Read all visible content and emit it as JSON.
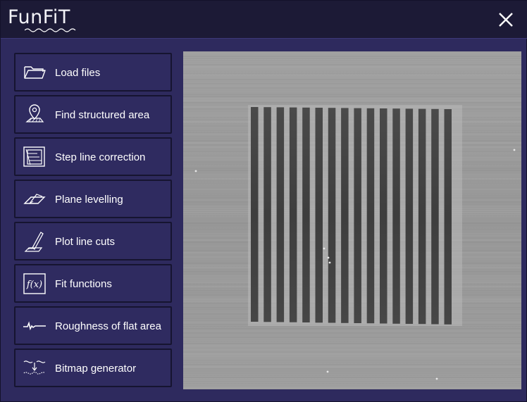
{
  "app": {
    "title": "FunFiT"
  },
  "titlebar": {
    "close_icon": "close-icon"
  },
  "sidebar": {
    "items": [
      {
        "label": "Load files",
        "icon": "folder-icon"
      },
      {
        "label": "Find structured area",
        "icon": "location-pin-icon"
      },
      {
        "label": "Step line correction",
        "icon": "step-correction-icon"
      },
      {
        "label": "Plane levelling",
        "icon": "plane-icon"
      },
      {
        "label": "Plot line cuts",
        "icon": "pen-plot-icon"
      },
      {
        "label": "Fit functions",
        "icon": "function-icon"
      },
      {
        "label": "Roughness of flat area",
        "icon": "profile-icon"
      },
      {
        "label": "Bitmap generator",
        "icon": "bitmap-icon"
      }
    ]
  },
  "colors": {
    "window_bg": "#2e2a5e",
    "titlebar_bg": "#1c1a36",
    "button_bg": "#2f2b60",
    "button_border": "#161430",
    "text": "#ffffff"
  },
  "viewer": {
    "content": "microscopy image of line grating"
  }
}
